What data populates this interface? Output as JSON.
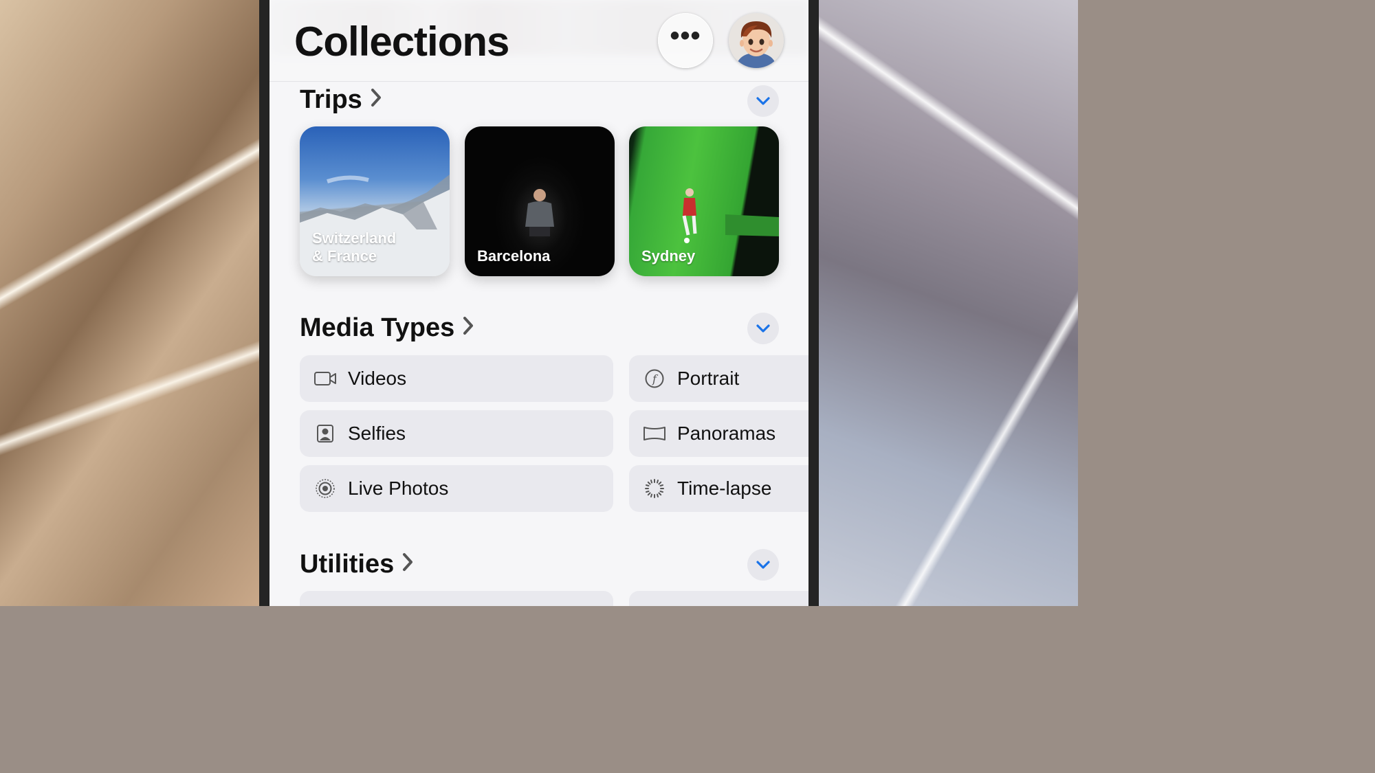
{
  "header": {
    "title": "Collections",
    "more_label": "•••"
  },
  "sections": {
    "trips": {
      "title": "Trips",
      "items": [
        {
          "label": "Switzerland\n& France"
        },
        {
          "label": "Barcelona"
        },
        {
          "label": "Sydney"
        }
      ]
    },
    "media_types": {
      "title": "Media Types",
      "left": [
        {
          "label": "Videos",
          "icon": "video-camera-icon"
        },
        {
          "label": "Selfies",
          "icon": "selfie-portrait-icon"
        },
        {
          "label": "Live Photos",
          "icon": "live-photo-icon"
        }
      ],
      "right": [
        {
          "label": "Portrait",
          "icon": "aperture-f-icon"
        },
        {
          "label": "Panoramas",
          "icon": "panorama-icon"
        },
        {
          "label": "Time-lapse",
          "icon": "timelapse-icon"
        }
      ]
    },
    "utilities": {
      "title": "Utilities"
    }
  },
  "colors": {
    "accent": "#1a73e8",
    "row_bg": "#e9e9ee"
  }
}
